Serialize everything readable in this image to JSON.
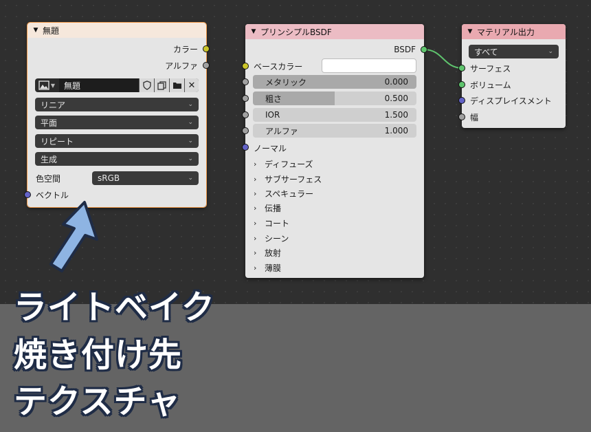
{
  "image_node": {
    "title": "無題",
    "outputs": [
      "カラー",
      "アルファ"
    ],
    "image_name": "無題",
    "interpolation": "リニア",
    "projection": "平面",
    "extension": "リピート",
    "source": "生成",
    "color_space_label": "色空間",
    "color_space": "sRGB",
    "input_vector": "ベクトル",
    "icons": [
      "image-icon",
      "shield-icon",
      "duplicate-icon",
      "folder-icon",
      "close-icon"
    ]
  },
  "bsdf_node": {
    "title": "プリンシプルBSDF",
    "output": "BSDF",
    "base_color_label": "ベースカラー",
    "base_color": "#ffffff",
    "fields": [
      {
        "label": "メタリック",
        "value": "0.000",
        "fraction": 1.0
      },
      {
        "label": "粗さ",
        "value": "0.500",
        "fraction": 0.5
      },
      {
        "label": "IOR",
        "value": "1.500",
        "fraction": 0.0
      },
      {
        "label": "アルファ",
        "value": "1.000",
        "fraction": 0.0
      }
    ],
    "normal_label": "ノーマル",
    "panels": [
      "ディフューズ",
      "サブサーフェス",
      "スペキュラー",
      "伝播",
      "コート",
      "シーン",
      "放射",
      "薄膜"
    ]
  },
  "output_node": {
    "title": "マテリアル出力",
    "target": "すべて",
    "inputs": [
      "サーフェス",
      "ボリューム",
      "ディスプレイスメント",
      "幅"
    ]
  },
  "caption": {
    "lines": [
      "ライトベイク",
      "焼き付け先",
      "テクスチャ"
    ]
  },
  "colors": {
    "image_header": "#f6e8dc",
    "bsdf_header": "#ecbcc4",
    "output_header": "#e9a9b0",
    "selection_outline": "#f29a48",
    "arrow_fill": "#8eb4e3",
    "link": "#5fc46e"
  }
}
